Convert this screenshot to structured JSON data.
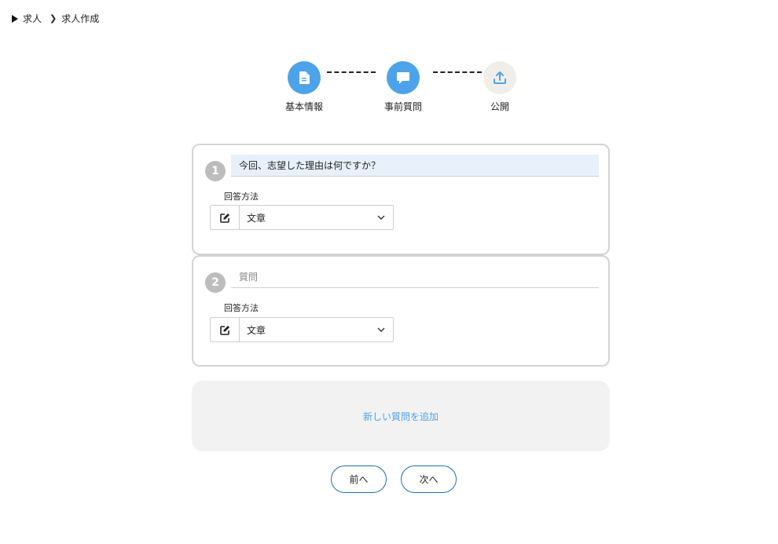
{
  "breadcrumb": {
    "root": "求人",
    "current": "求人作成"
  },
  "stepper": {
    "steps": [
      {
        "label": "基本情報",
        "icon": "document-icon",
        "state": "active"
      },
      {
        "label": "事前質問",
        "icon": "speech-bubble-icon",
        "state": "active"
      },
      {
        "label": "公開",
        "icon": "upload-icon",
        "state": "inactive"
      }
    ]
  },
  "questions": [
    {
      "number": "1",
      "text": "今回、志望した理由は何ですか？",
      "answer_label": "回答方法",
      "answer_value": "文章"
    },
    {
      "number": "2",
      "placeholder": "質問",
      "answer_label": "回答方法",
      "answer_value": "文章"
    }
  ],
  "add_question_label": "新しい質問を追加",
  "nav": {
    "prev_label": "前へ",
    "next_label": "次へ"
  },
  "colors": {
    "accent": "#4da3ea",
    "button_border": "#1f6fb8",
    "card_border": "#d3d3d3"
  }
}
